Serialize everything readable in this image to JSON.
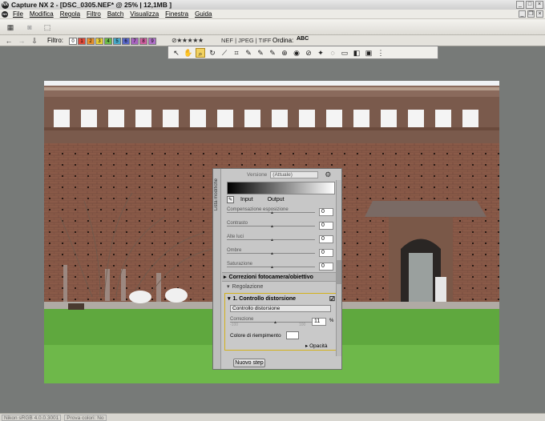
{
  "titlebar": {
    "title": "Capture NX 2 - [DSC_0305.NEF* @ 25% | 12,1MB ]",
    "icon": "NX"
  },
  "menu": [
    "File",
    "Modifica",
    "Regola",
    "Filtro",
    "Batch",
    "Visualizza",
    "Finestra",
    "Guida"
  ],
  "filter": {
    "label": "Filtro:",
    "chips": [
      {
        "label": "0",
        "color": "#ffffff"
      },
      {
        "label": "1",
        "color": "#e04a3a"
      },
      {
        "label": "2",
        "color": "#e8902e"
      },
      {
        "label": "3",
        "color": "#e9d03a"
      },
      {
        "label": "4",
        "color": "#6cba4a"
      },
      {
        "label": "5",
        "color": "#48a8c8"
      },
      {
        "label": "6",
        "color": "#5a68c8"
      },
      {
        "label": "7",
        "color": "#a864c0"
      },
      {
        "label": "8",
        "color": "#d060a0"
      },
      {
        "label": "9",
        "color": "#b070c8"
      }
    ],
    "stars": "⊘★★★★★",
    "formats": "NEF | JPEG | TIFF",
    "sort_label": "Ordina:",
    "sort_value": "ABC"
  },
  "edit_panel": {
    "side_tab": "Lista modifiche",
    "version_label": "Versione",
    "version_value": "(Attuale)",
    "input_label": "Input",
    "output_label": "Output",
    "sliders": [
      {
        "label": "Compensazione esposizione",
        "value": "0"
      },
      {
        "label": "Contrasto",
        "value": "0"
      },
      {
        "label": "Alte luci",
        "value": "0"
      },
      {
        "label": "Ombre",
        "value": "0"
      },
      {
        "label": "Saturazione",
        "value": "0"
      }
    ],
    "slider_min": "-100",
    "slider_max": "100",
    "section_corrections": "Correzioni fotocamera/obiettivo",
    "section_adjust": "Regolazione",
    "step_title": "1. Controllo distorsione",
    "step_select": "Controllo distorsione",
    "correction_label": "Correzione",
    "correction_value": "11",
    "correction_unit": "%",
    "fill_label": "Colore di riempimento",
    "opacity_label": "Opacità",
    "new_step": "Nuovo step"
  },
  "statusbar": {
    "profile": "Nikon sRGB 4.0.0.3001",
    "proof": "Prova colori: No"
  }
}
